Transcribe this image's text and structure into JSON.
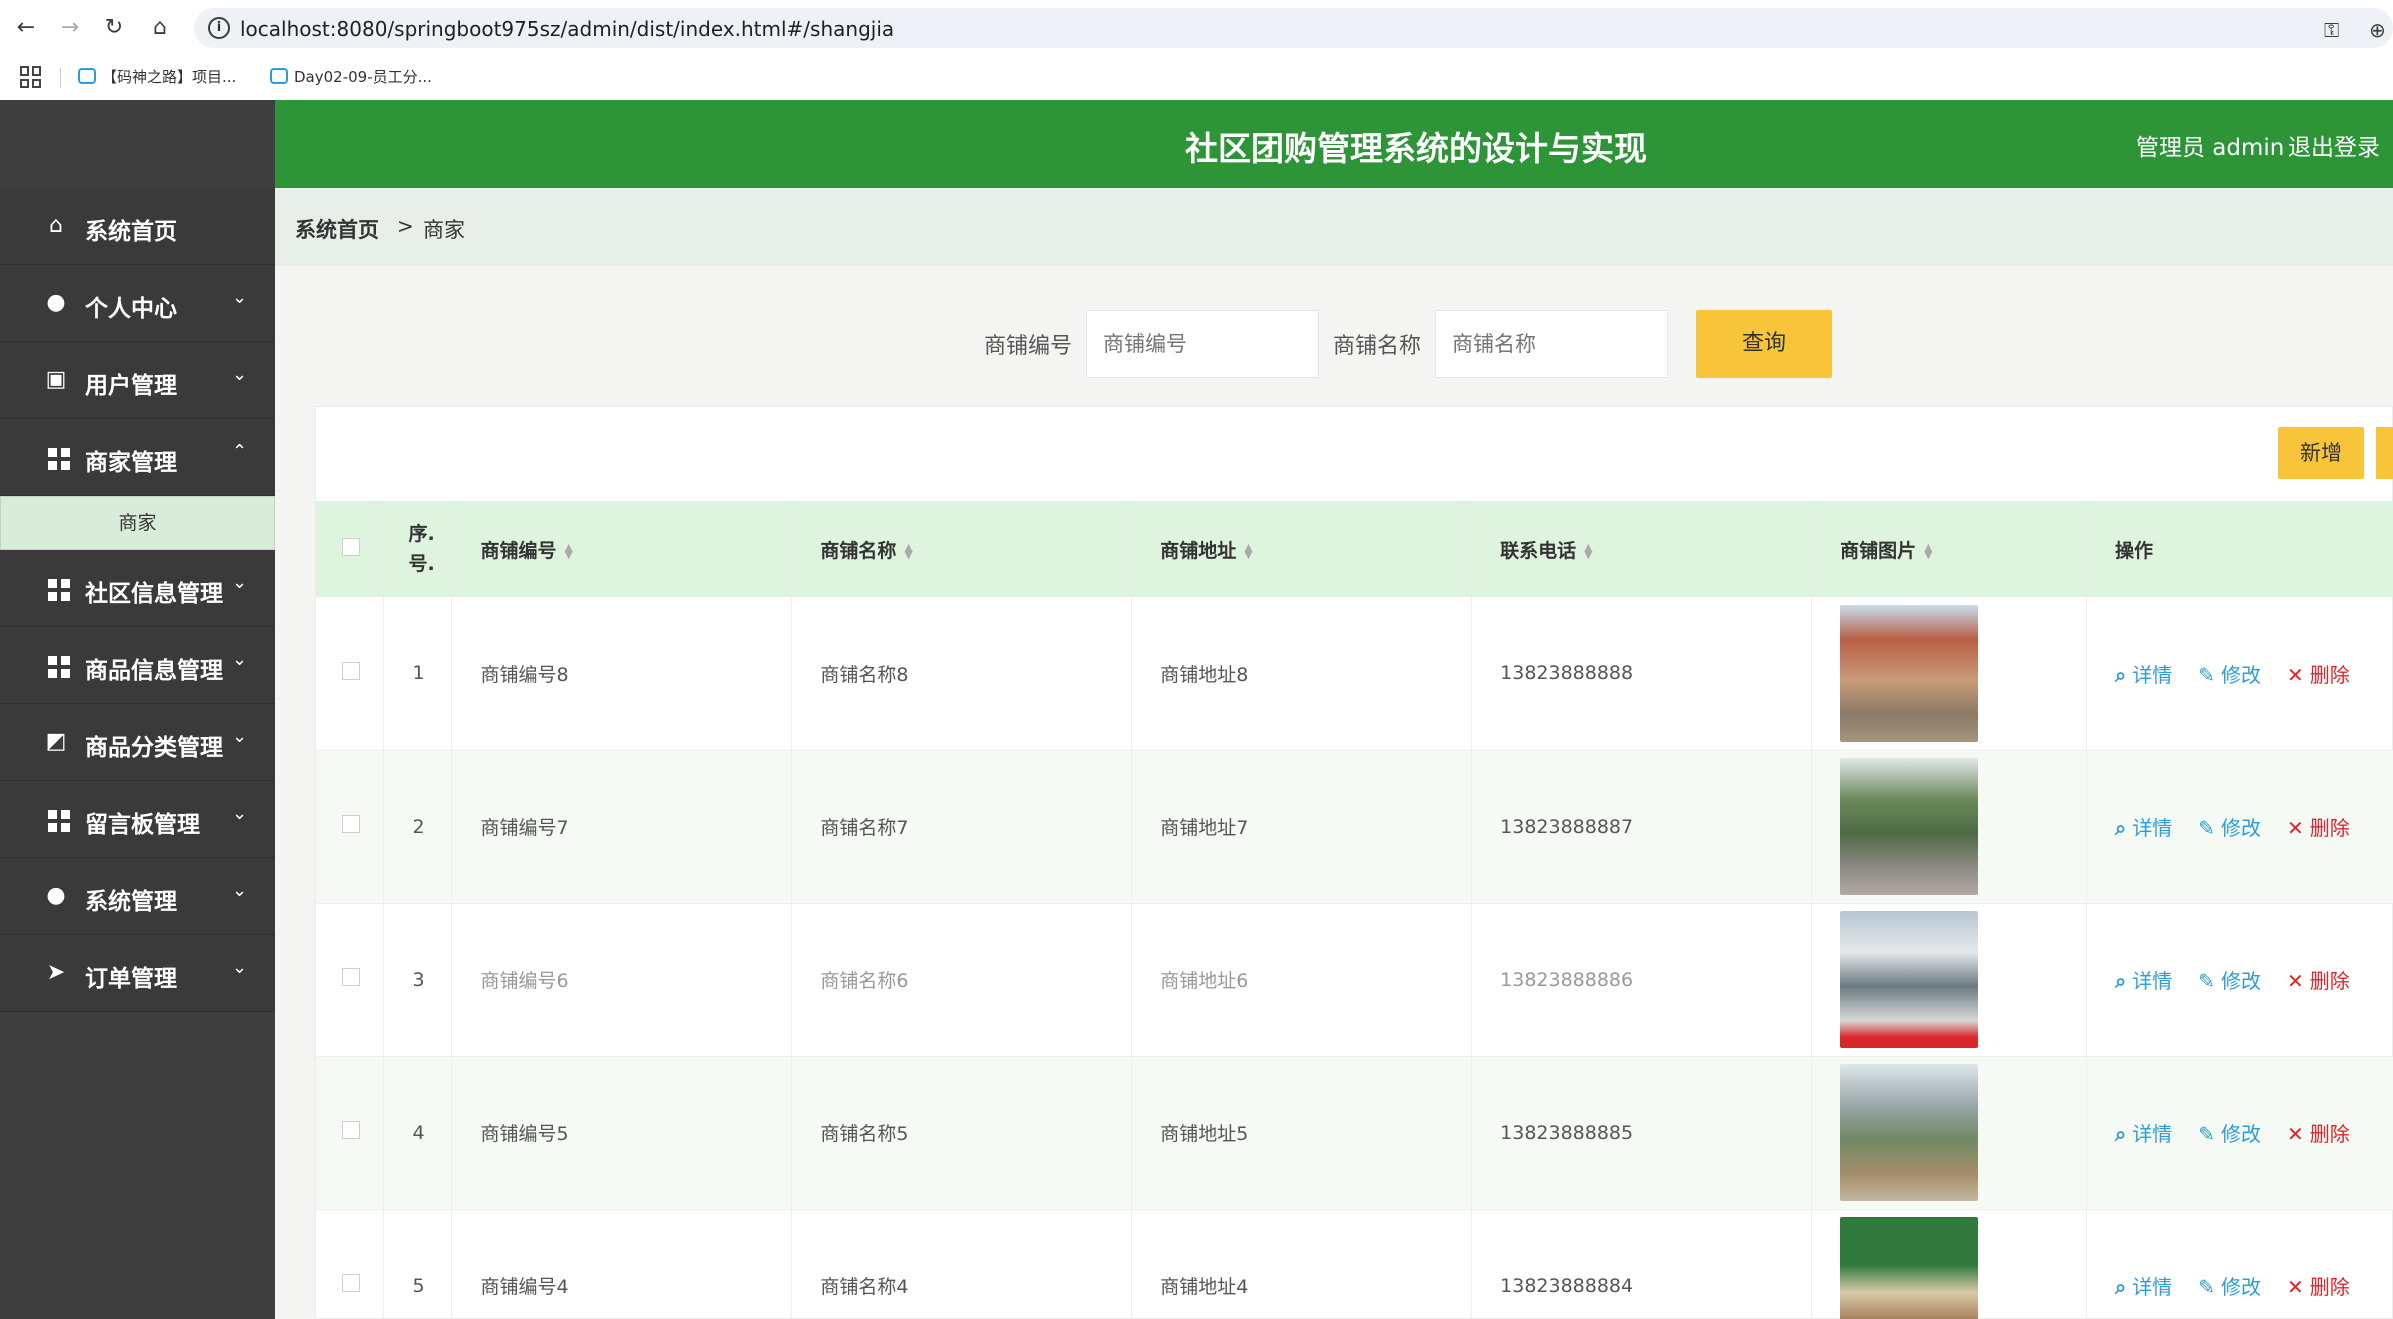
{
  "browser": {
    "url": "localhost:8080/springboot975sz/admin/dist/index.html#/shangjia",
    "bookmarks": [
      "【码神之路】项目...",
      "Day02-09-员工分..."
    ]
  },
  "header": {
    "title": "社区团购管理系统的设计与实现",
    "user": "管理员 admin",
    "logout": "退出登录"
  },
  "sidebar": {
    "items": [
      {
        "label": "系统首页",
        "icon": "home-icon"
      },
      {
        "label": "个人中心",
        "icon": "user-icon"
      },
      {
        "label": "用户管理",
        "icon": "clipboard-icon"
      },
      {
        "label": "商家管理",
        "icon": "grid-icon"
      },
      {
        "label": "社区信息管理",
        "icon": "grid-icon"
      },
      {
        "label": "商品信息管理",
        "icon": "grid-icon"
      },
      {
        "label": "商品分类管理",
        "icon": "chart-icon"
      },
      {
        "label": "留言板管理",
        "icon": "grid-icon"
      },
      {
        "label": "系统管理",
        "icon": "bulb-icon"
      },
      {
        "label": "订单管理",
        "icon": "send-icon"
      }
    ],
    "submenu_label": "商家"
  },
  "breadcrumb": {
    "home": "系统首页",
    "separator": ">",
    "current": "商家"
  },
  "search": {
    "field1_label": "商铺编号",
    "field1_placeholder": "商铺编号",
    "field2_label": "商铺名称",
    "field2_placeholder": "商铺名称",
    "query_label": "查询"
  },
  "toolbar": {
    "add_label": "新增"
  },
  "table": {
    "headers": {
      "index": "序.号.",
      "code": "商铺编号",
      "name": "商铺名称",
      "address": "商铺地址",
      "phone": "联系电话",
      "image": "商铺图片",
      "ops": "操作"
    },
    "rows": [
      {
        "index": "1",
        "code": "商铺编号8",
        "name": "商铺名称8",
        "address": "商铺地址8",
        "phone": "13823888888"
      },
      {
        "index": "2",
        "code": "商铺编号7",
        "name": "商铺名称7",
        "address": "商铺地址7",
        "phone": "13823888887"
      },
      {
        "index": "3",
        "code": "商铺编号6",
        "name": "商铺名称6",
        "address": "商铺地址6",
        "phone": "13823888886"
      },
      {
        "index": "4",
        "code": "商铺编号5",
        "name": "商铺名称5",
        "address": "商铺地址5",
        "phone": "13823888885"
      },
      {
        "index": "5",
        "code": "商铺编号4",
        "name": "商铺名称4",
        "address": "商铺地址4",
        "phone": "13823888884"
      }
    ],
    "actions": {
      "detail": "详情",
      "edit": "修改",
      "delete": "删除"
    }
  },
  "colors": {
    "header": "#2e9438",
    "sidebar": "#3f3f3f",
    "button": "#f7c43a",
    "link": "#2d9cdb",
    "danger": "#e0242b"
  }
}
